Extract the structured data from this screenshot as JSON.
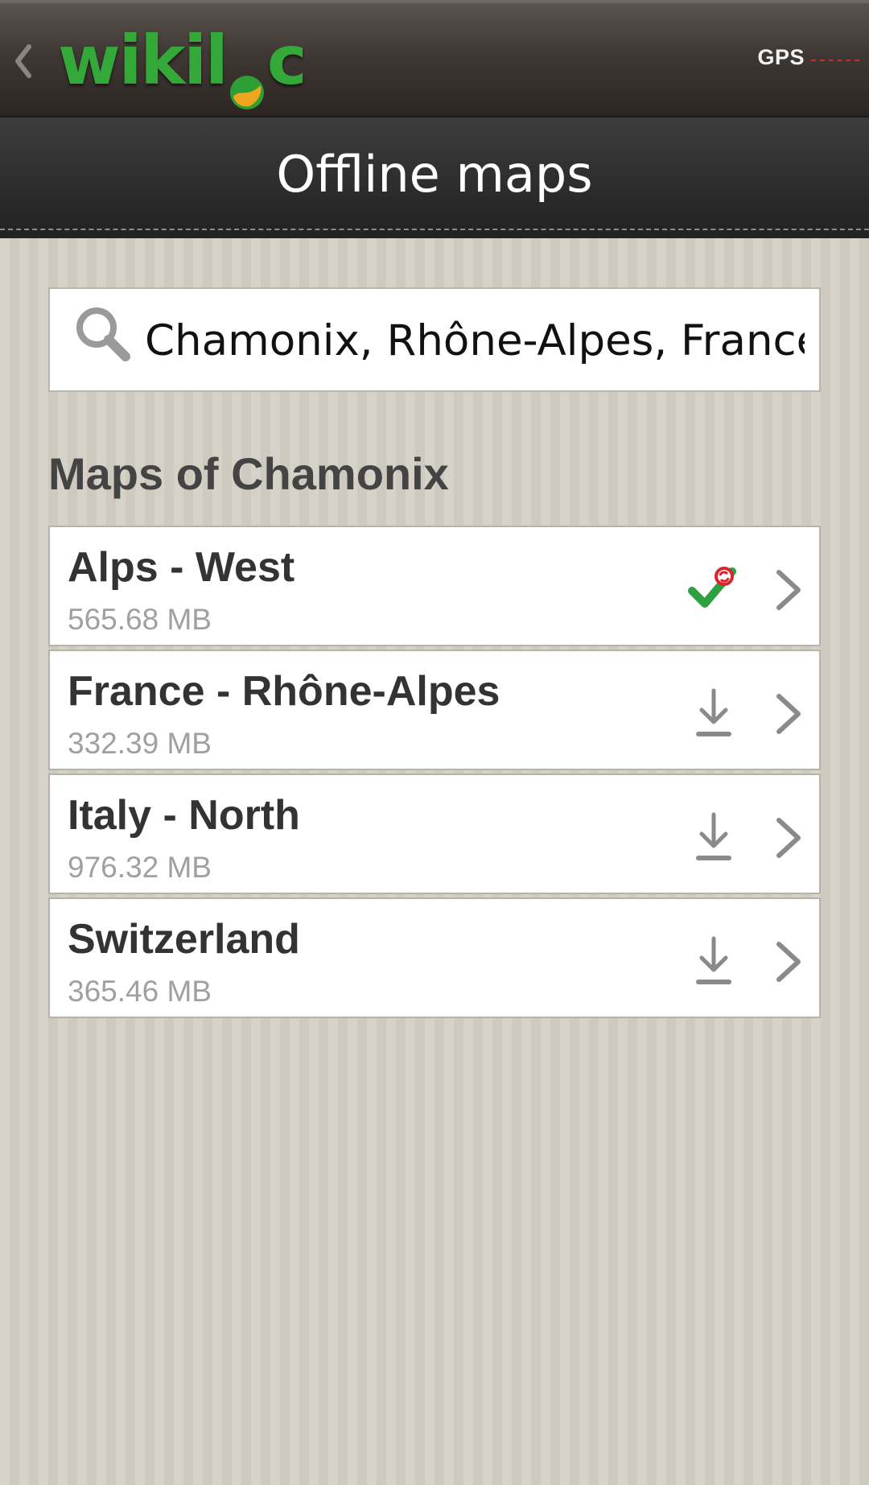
{
  "app_bar": {
    "brand": {
      "before": "wikil",
      "after": "c"
    },
    "gps_label": "GPS"
  },
  "title_bar": {
    "title": "Offline maps"
  },
  "search": {
    "value": "Chamonix, Rhône-Alpes, France"
  },
  "section": {
    "heading": "Maps of Chamonix"
  },
  "maps": [
    {
      "name": "Alps - West",
      "size": "565.68 MB",
      "status": "downloaded",
      "status_icon": "check-sync-icon"
    },
    {
      "name": "France - Rhône-Alpes",
      "size": "332.39 MB",
      "status": "available",
      "status_icon": "download-icon"
    },
    {
      "name": "Italy - North",
      "size": "976.32 MB",
      "status": "available",
      "status_icon": "download-icon"
    },
    {
      "name": "Switzerland",
      "size": "365.46 MB",
      "status": "available",
      "status_icon": "download-icon"
    }
  ],
  "colors": {
    "brand_green": "#35a83a",
    "check_green": "#2fa040",
    "sync_red": "#d7262e",
    "icon_gray": "#8a8a8a"
  }
}
